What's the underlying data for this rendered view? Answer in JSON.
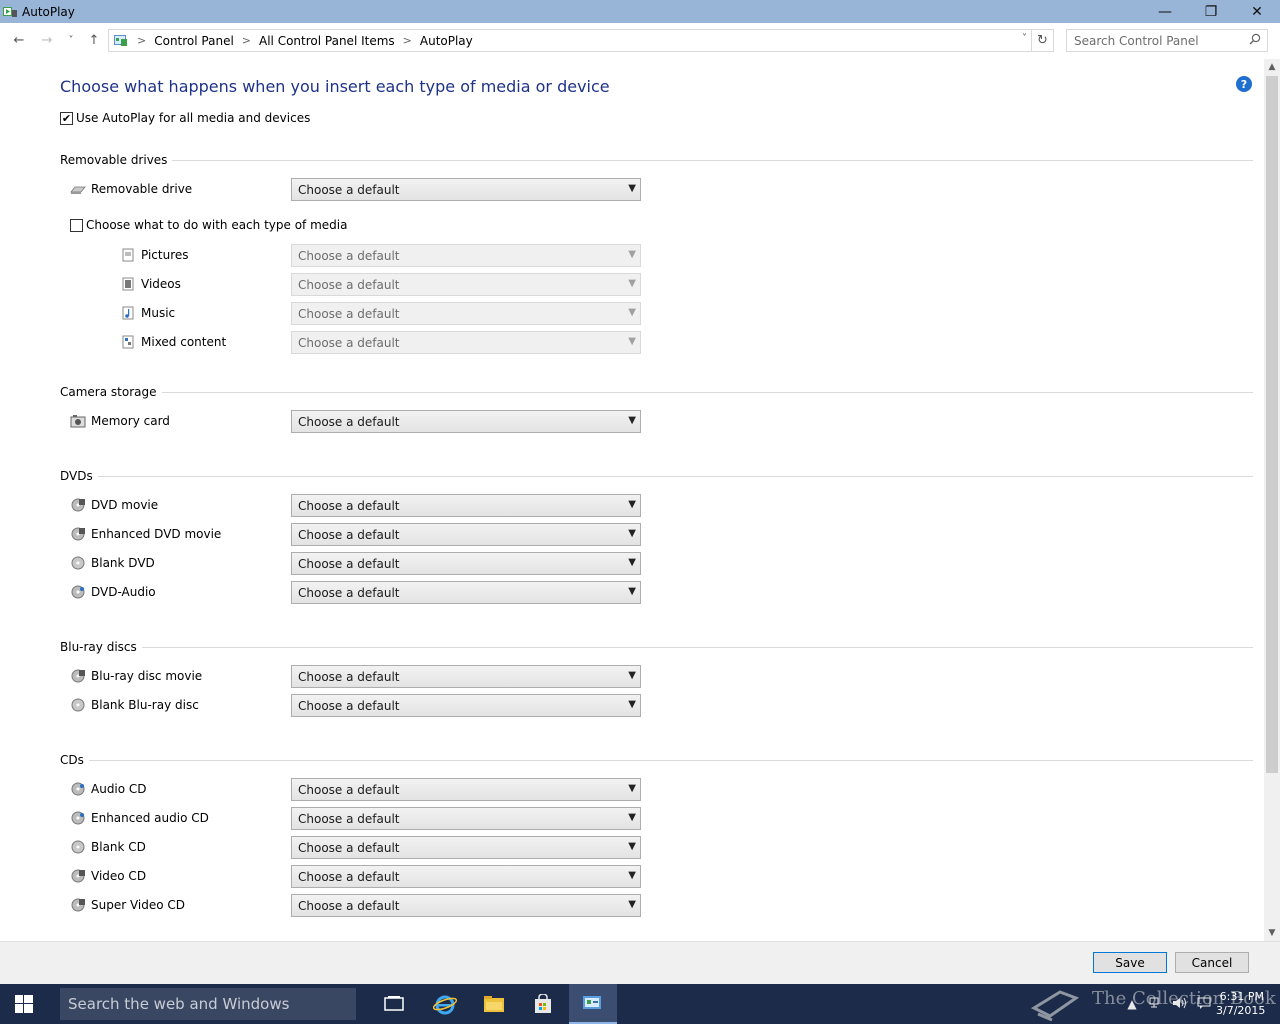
{
  "window": {
    "title": "AutoPlay",
    "minimize": "—",
    "maximize": "❐",
    "close": "✕"
  },
  "nav": {
    "back": "←",
    "forward": "→",
    "recent": "˅",
    "up": "↑",
    "breadcrumb": [
      "Control Panel",
      "All Control Panel Items",
      "AutoPlay"
    ],
    "crumb_sep": ">",
    "refresh": "↻",
    "search_placeholder": "Search Control Panel"
  },
  "page": {
    "title": "Choose what happens when you insert each type of media or device",
    "help": "?",
    "use_autoplay_label": "Use AutoPlay for all media and devices",
    "use_autoplay_checked": "✔",
    "each_media_label": "Choose what to do with each type of media"
  },
  "default_option": "Choose a default",
  "sections": {
    "removable": {
      "heading": "Removable drives",
      "items": [
        "Removable drive"
      ]
    },
    "media": {
      "items": [
        "Pictures",
        "Videos",
        "Music",
        "Mixed content"
      ]
    },
    "camera": {
      "heading": "Camera storage",
      "items": [
        "Memory card"
      ]
    },
    "dvds": {
      "heading": "DVDs",
      "items": [
        "DVD movie",
        "Enhanced DVD movie",
        "Blank DVD",
        "DVD-Audio"
      ]
    },
    "bluray": {
      "heading": "Blu-ray discs",
      "items": [
        "Blu-ray disc movie",
        "Blank Blu-ray disc"
      ]
    },
    "cds": {
      "heading": "CDs",
      "items": [
        "Audio CD",
        "Enhanced audio CD",
        "Blank CD",
        "Video CD",
        "Super Video CD"
      ]
    }
  },
  "buttons": {
    "save": "Save",
    "cancel": "Cancel"
  },
  "taskbar": {
    "search_text": "Search the web and Windows",
    "time": "6:31 PM",
    "date": "3/7/2015",
    "watermark": "The Collection Book"
  },
  "colors": {
    "title_bar": "#98b4d6",
    "heading_blue": "#1e3287",
    "taskbar": "#1c2b4a"
  }
}
